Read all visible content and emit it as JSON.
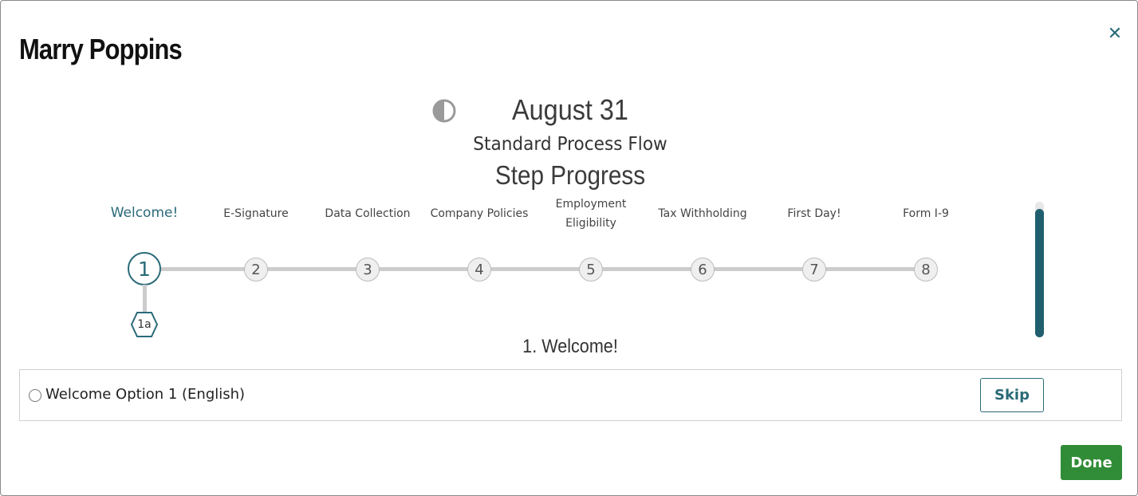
{
  "modal": {
    "title": "Marry Poppins",
    "close_icon": "close-icon",
    "close_symbol": "✕"
  },
  "header": {
    "contrast_icon": "contrast-icon",
    "date": "August 31",
    "flow_name": "Standard Process Flow",
    "section_title": "Step Progress"
  },
  "steps": [
    {
      "number": "1",
      "label": "Welcome!",
      "active": true
    },
    {
      "number": "2",
      "label": "E-Signature",
      "active": false
    },
    {
      "number": "3",
      "label": "Data Collection",
      "active": false
    },
    {
      "number": "4",
      "label": "Company Policies",
      "active": false
    },
    {
      "number": "5",
      "label": "Employment Eligibility",
      "active": false
    },
    {
      "number": "6",
      "label": "Tax Withholding",
      "active": false
    },
    {
      "number": "7",
      "label": "First Day!",
      "active": false
    },
    {
      "number": "8",
      "label": "Form I-9",
      "active": false
    }
  ],
  "sub_step": {
    "label": "1a"
  },
  "current_step": {
    "title": "1. Welcome!",
    "options": [
      {
        "label": "Welcome Option 1 (English)",
        "selected": false
      }
    ],
    "skip_label": "Skip"
  },
  "footer": {
    "done_label": "Done"
  },
  "colors": {
    "accent": "#2a6a78",
    "done_green": "#318c37",
    "track_gray": "#cccccc",
    "scroll_thumb": "#215f6f"
  }
}
